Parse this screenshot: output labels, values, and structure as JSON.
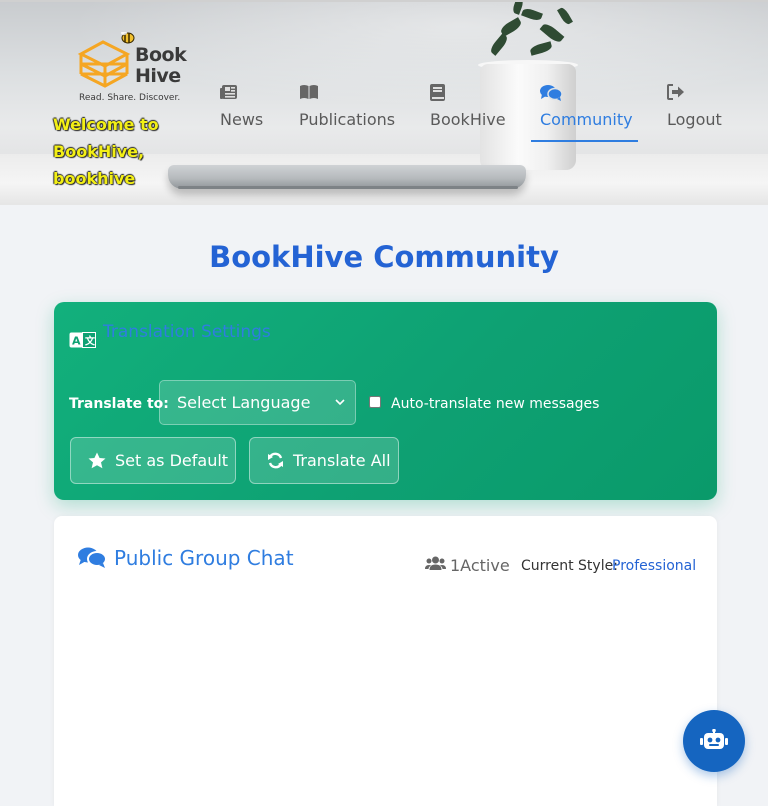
{
  "brand": {
    "name_line1": "Book",
    "name_line2": "Hive",
    "tagline": "Read. Share. Discover.",
    "welcome": "Welcome to BookHive, bookhive"
  },
  "nav": {
    "items": [
      {
        "label": "News",
        "icon": "newspaper-icon"
      },
      {
        "label": "Publications",
        "icon": "book-open-icon"
      },
      {
        "label": "BookHive",
        "icon": "book-icon"
      },
      {
        "label": "Community",
        "icon": "comments-icon",
        "active": true
      },
      {
        "label": "Logout",
        "icon": "logout-icon"
      }
    ]
  },
  "page": {
    "title": "BookHive Community"
  },
  "translation": {
    "title": "Translation Settings",
    "translate_to_label": "Translate to:",
    "language_select": {
      "selected": "Select Language"
    },
    "auto_translate_label": "Auto-translate new messages",
    "auto_translate_checked": false,
    "set_default_label": "Set as Default",
    "translate_all_label": "Translate All"
  },
  "chat": {
    "title": "Public Group Chat",
    "active_count": "1Active",
    "style_label": "Current Style:",
    "style_value": "Professional"
  },
  "colors": {
    "accent_blue": "#2f7de0",
    "title_blue": "#2463d4",
    "translation_green": "#0ea173",
    "welcome_yellow": "#f3ef16",
    "bot_button": "#1565c0"
  }
}
